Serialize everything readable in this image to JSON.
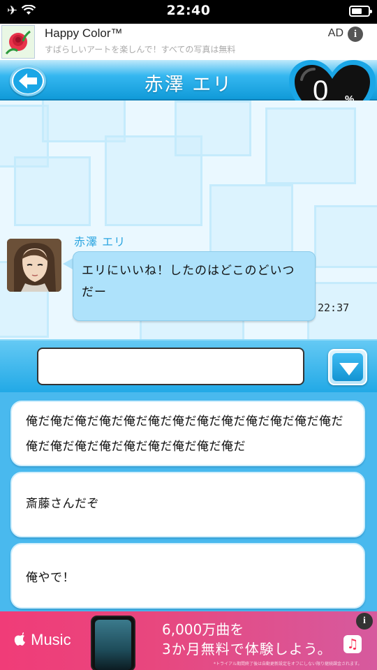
{
  "status_bar": {
    "time": "22:40",
    "icons": [
      "airplane-mode-icon",
      "wifi-icon",
      "battery-icon"
    ]
  },
  "top_ad": {
    "title": "Happy Color™",
    "subtitle": "すばらしいアートを楽しんで！すべての写真は無料",
    "ad_label": "AD",
    "info_glyph": "i"
  },
  "header": {
    "title": "赤澤 エリ",
    "back_icon": "back-arrow-icon"
  },
  "heart_meter": {
    "value": "0",
    "unit": "%",
    "level": 0
  },
  "chat": {
    "messages": [
      {
        "sender": "赤澤 エリ",
        "text": "エリにいいね！したのはどこのどいつだー",
        "time": "22:37"
      }
    ]
  },
  "input": {
    "value": "",
    "placeholder": "",
    "dropdown_icon": "triangle-down-icon"
  },
  "choices": [
    {
      "text": "俺だ俺だ俺だ俺だ俺だ俺だ俺だ俺だ俺だ俺だ俺だ俺だ俺だ俺だ俺だ俺だ俺だ俺だ俺だ俺だ俺だ俺だ"
    },
    {
      "text": "斎藤さんだぞ"
    },
    {
      "text": "俺やで！"
    }
  ],
  "bottom_ad": {
    "brand": "Music",
    "line1": "6,000万曲を",
    "line2": "3か月無料で体験しよう。",
    "fine_print": "*トライアル期間終了後は自動更新設定をオフにしない限り継続課金されます。",
    "info_glyph": "i",
    "icon": "music-note-icon"
  },
  "colors": {
    "accent": "#1aa6e6",
    "bubble": "#aee2fb",
    "name": "#2ba5e0",
    "ad_pink": "#f03c78"
  }
}
